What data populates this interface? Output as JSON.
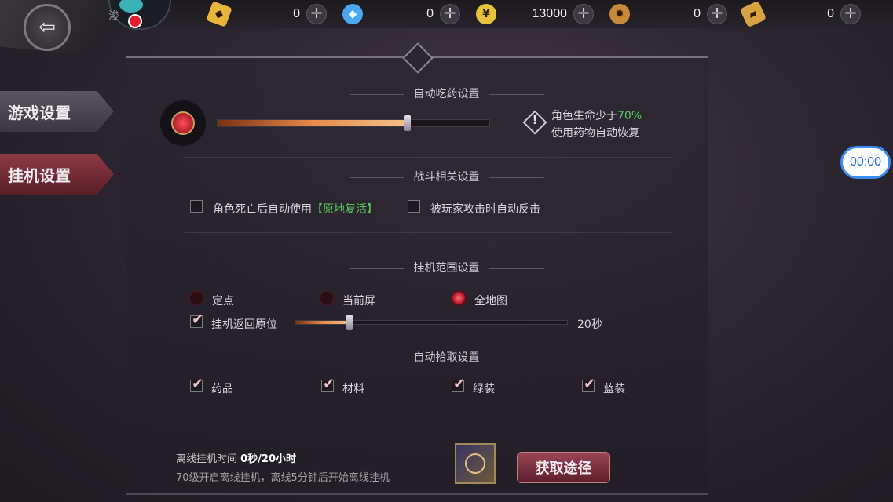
{
  "topbar": {
    "avatar_name": "浚",
    "resources": [
      {
        "icon": "gold-ingot-icon",
        "color": "#e8b43a",
        "value": "0"
      },
      {
        "icon": "diamond-icon",
        "color": "#4aa8ee",
        "value": "0"
      },
      {
        "icon": "gold-coin-icon",
        "color": "#e8c23a",
        "value": "13000"
      },
      {
        "icon": "medal-icon",
        "color": "#c88a3a",
        "value": "0"
      },
      {
        "icon": "ticket-icon",
        "color": "#d8a442",
        "value": "0"
      }
    ]
  },
  "sidebar": {
    "tabs": [
      {
        "label": "游戏设置",
        "active": false
      },
      {
        "label": "挂机设置",
        "active": true
      }
    ]
  },
  "potion": {
    "title": "自动吃药设置",
    "slider_percent": 70,
    "hint_line1": "角色生命少于",
    "hint_value": "70%",
    "hint_line2": "使用药物自动恢复"
  },
  "combat": {
    "title": "战斗相关设置",
    "option1_label": "角色死亡后自动使用",
    "option1_highlight": "【原地复活】",
    "option1_checked": false,
    "option2_label": "被玩家攻击时自动反击",
    "option2_checked": false
  },
  "range": {
    "title": "挂机范围设置",
    "options": [
      "定点",
      "当前屏",
      "全地图"
    ],
    "selected": "全地图",
    "return_label": "挂机返回原位",
    "return_checked": true,
    "return_slider_fraction": 0.2,
    "return_value": "20秒"
  },
  "pickup": {
    "title": "自动拾取设置",
    "items": [
      {
        "label": "药品",
        "checked": true
      },
      {
        "label": "材料",
        "checked": true
      },
      {
        "label": "绿装",
        "checked": true
      },
      {
        "label": "蓝装",
        "checked": true
      }
    ]
  },
  "offline": {
    "time_label": "离线挂机时间 ",
    "time_value": "0秒/20小时",
    "hint": "70级开启离线挂机，离线5分钟后开始离线挂机",
    "button_label": "获取途径"
  },
  "overlay": {
    "timer": "00:00"
  },
  "colors": {
    "accent_green": "#5ac85a",
    "active_tab": "#8d3a45",
    "slider_fill": "#e88a4a"
  }
}
